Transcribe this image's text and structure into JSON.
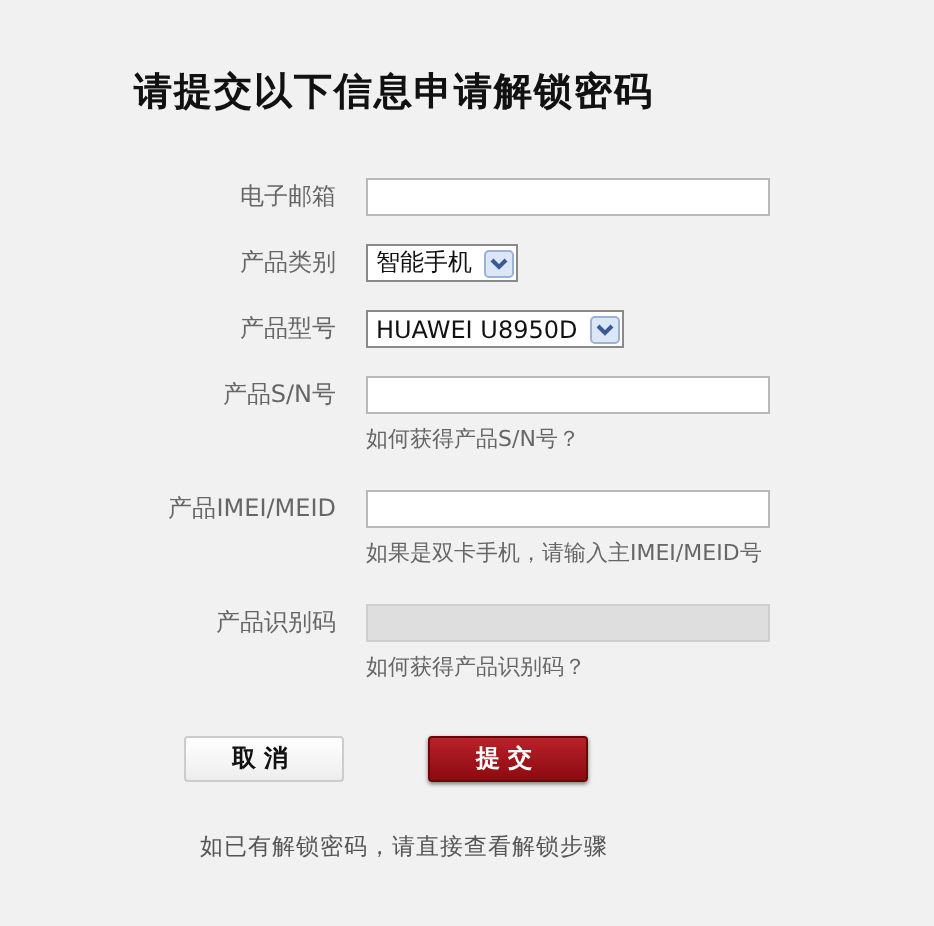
{
  "title": "请提交以下信息申请解锁密码",
  "fields": [
    {
      "kind": "text",
      "label": "电子邮箱",
      "disabled": false
    },
    {
      "kind": "select",
      "label": "产品类别",
      "value": "智能手机"
    },
    {
      "kind": "select",
      "label": "产品型号",
      "value": "HUAWEI U8950D"
    },
    {
      "kind": "text",
      "label": "产品S/N号",
      "hint": "如何获得产品S/N号？",
      "disabled": false
    },
    {
      "kind": "text",
      "label": "产品IMEI/MEID",
      "hint": "如果是双卡手机，请输入主IMEI/MEID号",
      "disabled": false
    },
    {
      "kind": "text",
      "label": "产品识别码",
      "hint": "如何获得产品识别码？",
      "disabled": true
    }
  ],
  "buttons": [
    {
      "kind": "secondary",
      "label": "取消"
    },
    {
      "kind": "primary",
      "label": "提交"
    }
  ],
  "footer_note": "如已有解锁密码，请直接查看解锁步骤"
}
